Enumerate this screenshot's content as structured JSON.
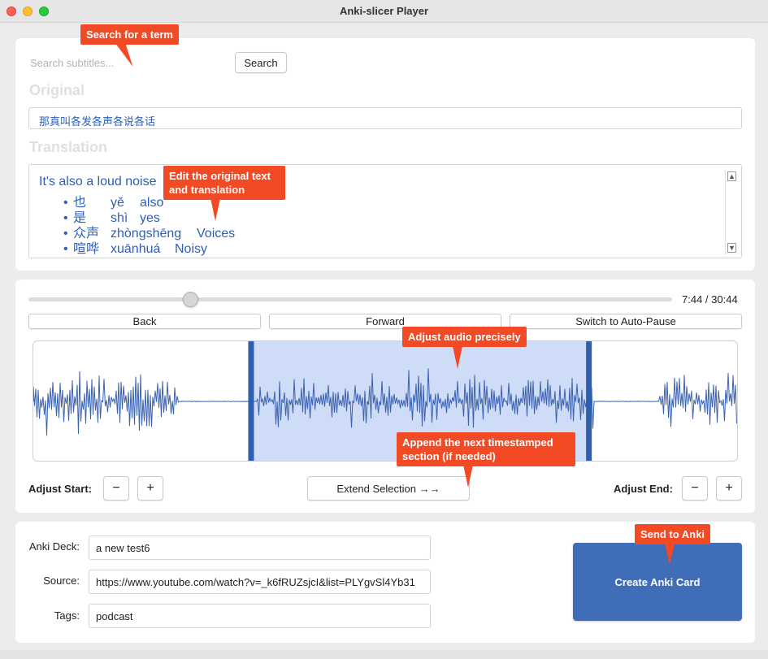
{
  "window": {
    "title": "Anki-slicer Player"
  },
  "search": {
    "placeholder": "Search subtitles...",
    "button": "Search"
  },
  "original": {
    "heading": "Original",
    "text": "那真叫各发各声各说各话"
  },
  "translation": {
    "heading": "Translation",
    "main": "It's also a loud noise",
    "bullets": [
      {
        "hanzi": "也",
        "pinyin": "yě",
        "gloss": "also"
      },
      {
        "hanzi": "是",
        "pinyin": "shì",
        "gloss": "yes"
      },
      {
        "hanzi": "众声",
        "pinyin": "zhòngshēng",
        "gloss": "Voices"
      },
      {
        "hanzi": "喧哗",
        "pinyin": "xuānhuá",
        "gloss": "Noisy"
      }
    ]
  },
  "player": {
    "time": "7:44 / 30:44",
    "progress": 0.252,
    "back": "Back",
    "forward": "Forward",
    "auto_pause": "Switch to Auto-Pause",
    "selection_start": 0.31,
    "selection_end": 0.79
  },
  "adjust": {
    "start_label": "Adjust Start:",
    "end_label": "Adjust End:",
    "minus": "−",
    "plus": "+",
    "extend": "Extend Selection →→"
  },
  "card": {
    "deck_label": "Anki Deck:",
    "deck": "a new test6",
    "source_label": "Source:",
    "source": "https://www.youtube.com/watch?v=_k6fRUZsjcI&list=PLYgvSl4Yb31",
    "tags_label": "Tags:",
    "tags": "podcast",
    "create": "Create Anki Card"
  },
  "callouts": {
    "search": "Search for a term",
    "edit": "Edit the original text and translation",
    "adjust": "Adjust audio precisely",
    "append": "Append the next timestamped section (if needed)",
    "send": "Send to Anki"
  },
  "colors": {
    "accent": "#3f6db8",
    "callout": "#f24a25",
    "waveform": "#3a62b0",
    "selection": "#cfdcf7",
    "selection_handle": "#2f5faf"
  }
}
